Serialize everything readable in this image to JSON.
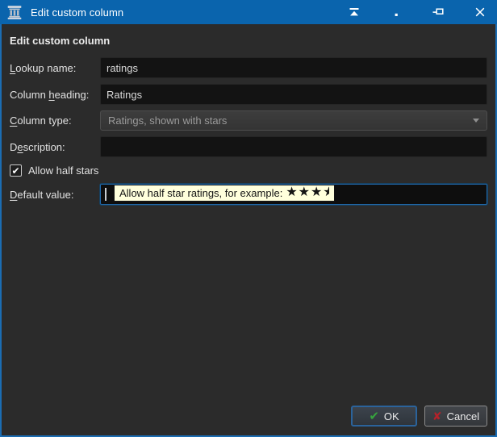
{
  "window": {
    "title": "Edit custom column"
  },
  "colors": {
    "titlebar_bg": "#0a64ad",
    "window_border": "#1b6db3",
    "body_bg": "#2b2b2b",
    "input_bg": "#131313",
    "disabled_field_bg": "#383838",
    "focus_border": "#2168a9",
    "tooltip_bg": "#ffffdc",
    "ok_border_blue": "#2b639b",
    "check_green": "#36a33e",
    "cross_red": "#b5222a"
  },
  "icons": {
    "app": "calibre-pillar-icon",
    "shade": "shade-window-icon",
    "minimize": "minimize-icon",
    "pin": "keep-above-pin-icon",
    "close": "close-icon",
    "dropdown_arrow": "chevron-down-icon"
  },
  "form": {
    "heading": "Edit custom column",
    "lookup_name": {
      "label_pre": "",
      "label_mnemonic": "L",
      "label_post": "ookup name:",
      "value": "ratings"
    },
    "column_heading": {
      "label_pre": "Column ",
      "label_mnemonic": "h",
      "label_post": "eading:",
      "value": "Ratings"
    },
    "column_type": {
      "label_pre": "",
      "label_mnemonic": "C",
      "label_post": "olumn type:",
      "value": "Ratings, shown with stars",
      "disabled": true
    },
    "description": {
      "label_pre": "D",
      "label_mnemonic": "e",
      "label_post": "scription:",
      "value": ""
    },
    "allow_half_stars": {
      "label": "Allow half stars",
      "checked": true,
      "checkmark": "✔"
    },
    "default_value": {
      "label_pre": "",
      "label_mnemonic": "D",
      "label_post": "efault value:",
      "value": ""
    }
  },
  "tooltip": {
    "text": "Allow half star ratings, for example:",
    "full_stars": "★★★",
    "half_star": "★"
  },
  "buttons": {
    "ok_label": "OK",
    "ok_icon": "✔",
    "cancel_label": "Cancel",
    "cancel_icon": "✘"
  }
}
